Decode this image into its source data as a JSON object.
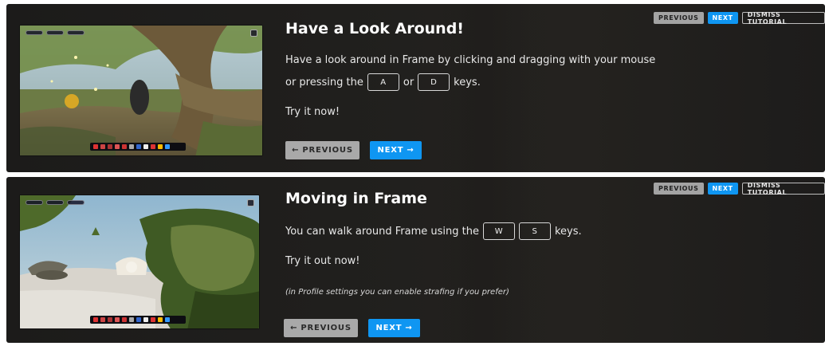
{
  "top_controls": {
    "previous": "PREVIOUS",
    "next": "NEXT",
    "dismiss": "DISMISS TUTORIAL"
  },
  "steps": [
    {
      "title": "Have a Look Around!",
      "line1": "Have a look around in Frame by clicking and dragging with your mouse",
      "line2_before": "or pressing the",
      "key_a": "A",
      "line2_mid": "or",
      "key_d": "D",
      "line2_after": "keys.",
      "try_text": "Try it now!",
      "prev_label": "PREVIOUS",
      "next_label": "NEXT",
      "prev_arrow": "←",
      "next_arrow": "→",
      "screenshot_icon": "forest-scene-screenshot"
    },
    {
      "title": "Moving in Frame",
      "line1_before": "You can walk around Frame using the",
      "key_w": "W",
      "key_s": "S",
      "line1_after": "keys.",
      "try_text": "Try it out now!",
      "note": "(in Profile settings you can enable strafing if you prefer)",
      "prev_label": "PREVIOUS",
      "next_label": "NEXT",
      "prev_arrow": "←",
      "next_arrow": "→",
      "screenshot_icon": "zen-garden-scene-screenshot"
    }
  ],
  "colors": {
    "accent_blue": "#0f96f2",
    "button_gray": "#a9a9a9",
    "panel_bg": "#1f1e1c"
  }
}
